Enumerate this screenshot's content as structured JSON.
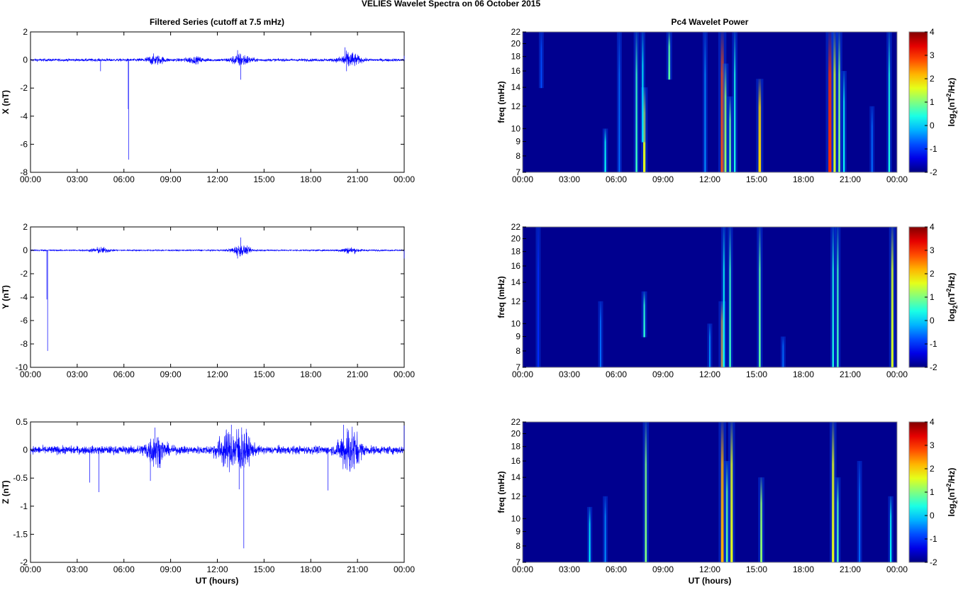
{
  "title": "VELIES Wavelet Spectra on 06 October   2015",
  "left_title": "Filtered Series (cutoff at 7.5 mHz)",
  "right_title": "Pc4 Wavelet Power",
  "xlabel": "UT (hours)",
  "xticks": [
    "00:00",
    "03:00",
    "06:00",
    "09:00",
    "12:00",
    "15:00",
    "18:00",
    "21:00",
    "00:00"
  ],
  "colors": {
    "series": "#0000ff",
    "background": "#00008f"
  },
  "chart_data": {
    "type": "line",
    "x_range_hours": [
      0,
      24
    ],
    "time_series": [
      {
        "ylabel": "X (nT)",
        "ylim": [
          -8,
          2
        ],
        "yticks": [
          "-8",
          "-6",
          "-4",
          "-2",
          "0",
          "2"
        ],
        "yvals": [
          -8,
          -6,
          -4,
          -2,
          0,
          2
        ],
        "noise_amp": 0.08,
        "bursts": [
          [
            8.0,
            0.25
          ],
          [
            13.5,
            0.35
          ],
          [
            20.5,
            0.45
          ],
          [
            10.5,
            0.15
          ]
        ],
        "spikes": [
          [
            6.3,
            -7.1
          ],
          [
            6.28,
            -3.5
          ],
          [
            4.5,
            -0.8
          ],
          [
            13.5,
            -1.4
          ],
          [
            13.3,
            0.7
          ],
          [
            20.2,
            0.9
          ],
          [
            20.3,
            -0.8
          ],
          [
            24.0,
            0.3
          ]
        ]
      },
      {
        "ylabel": "Y (nT)",
        "ylim": [
          -10,
          2
        ],
        "yticks": [
          "-10",
          "-8",
          "-6",
          "-4",
          "-2",
          "0",
          "2"
        ],
        "yvals": [
          -10,
          -8,
          -6,
          -4,
          -2,
          0,
          2
        ],
        "noise_amp": 0.05,
        "bursts": [
          [
            13.5,
            0.35
          ],
          [
            20.5,
            0.2
          ],
          [
            4.5,
            0.2
          ]
        ],
        "spikes": [
          [
            1.1,
            -8.6
          ],
          [
            1.05,
            -4.2
          ],
          [
            13.5,
            1.1
          ],
          [
            13.3,
            -0.7
          ],
          [
            24.0,
            -0.7
          ]
        ]
      },
      {
        "ylabel": "Z (nT)",
        "ylim": [
          -2,
          0.5
        ],
        "yticks": [
          "-2",
          "-1.5",
          "-1",
          "-0.5",
          "0",
          "0.5"
        ],
        "yvals": [
          -2,
          -1.5,
          -1,
          -0.5,
          0,
          0.5
        ],
        "noise_amp": 0.06,
        "bursts": [
          [
            8.0,
            0.2
          ],
          [
            13.5,
            0.3
          ],
          [
            20.5,
            0.35
          ],
          [
            12.5,
            0.2
          ]
        ],
        "spikes": [
          [
            13.7,
            -1.75
          ],
          [
            4.4,
            -0.75
          ],
          [
            3.8,
            -0.58
          ],
          [
            19.1,
            -0.72
          ],
          [
            13.4,
            -0.7
          ],
          [
            7.7,
            -0.55
          ],
          [
            8.0,
            0.4
          ],
          [
            12.9,
            0.45
          ],
          [
            20.1,
            0.45
          ],
          [
            24.0,
            0.5
          ]
        ]
      }
    ],
    "spectra": {
      "ylabel": "freq (mHz)",
      "ylim_mhz": [
        7,
        22
      ],
      "yscale": "log",
      "yticks": [
        "7",
        "8",
        "9",
        "10",
        "12",
        "14",
        "16",
        "18",
        "20",
        "22"
      ],
      "yvals": [
        7,
        8,
        9,
        10,
        12,
        14,
        16,
        18,
        20,
        22
      ],
      "clim": [
        -2,
        4
      ],
      "colorbar_ticks": [
        "-2",
        "-1",
        "0",
        "1",
        "2",
        "3",
        "4"
      ],
      "colorbar_vals": [
        -2,
        -1,
        0,
        1,
        2,
        3,
        4
      ],
      "colorbar_label": [
        "log",
        "2",
        "(nT",
        "2",
        "/Hz)"
      ],
      "panels": [
        {
          "events_hour_fmin_fmax_log2power": [
            [
              1.2,
              14,
              22,
              -0.8
            ],
            [
              5.3,
              7,
              10,
              0.3
            ],
            [
              6.2,
              7,
              22,
              -0.6
            ],
            [
              7.3,
              7,
              22,
              0.6
            ],
            [
              7.8,
              7,
              14,
              1.6
            ],
            [
              7.7,
              9,
              22,
              0.2
            ],
            [
              9.4,
              15,
              22,
              0.8
            ],
            [
              11.7,
              7,
              22,
              -0.4
            ],
            [
              12.8,
              7,
              22,
              2.8
            ],
            [
              13.0,
              7,
              17,
              1.1
            ],
            [
              13.3,
              7,
              13,
              0.8
            ],
            [
              13.6,
              7,
              22,
              0.4
            ],
            [
              15.2,
              7,
              15,
              2.0
            ],
            [
              19.7,
              7,
              22,
              3.0
            ],
            [
              20.0,
              7,
              22,
              1.5
            ],
            [
              20.3,
              7,
              22,
              1.0
            ],
            [
              20.6,
              7,
              16,
              0.3
            ],
            [
              22.4,
              7,
              12,
              -0.6
            ],
            [
              23.5,
              7,
              22,
              0.4
            ]
          ]
        },
        {
          "events_hour_fmin_fmax_log2power": [
            [
              1.0,
              7,
              22,
              -1.0
            ],
            [
              5.0,
              7,
              12,
              -0.6
            ],
            [
              7.8,
              9,
              13,
              0.5
            ],
            [
              12.0,
              7,
              10,
              -0.4
            ],
            [
              12.8,
              7,
              12,
              2.2
            ],
            [
              12.9,
              7,
              22,
              0.3
            ],
            [
              13.3,
              7,
              22,
              0.6
            ],
            [
              15.2,
              7,
              22,
              0.8
            ],
            [
              16.7,
              7,
              9,
              -0.6
            ],
            [
              19.9,
              7,
              22,
              0.4
            ],
            [
              20.2,
              7,
              22,
              0.6
            ],
            [
              23.7,
              7,
              22,
              1.5
            ]
          ]
        },
        {
          "events_hour_fmin_fmax_log2power": [
            [
              4.3,
              7,
              11,
              0.2
            ],
            [
              5.3,
              7,
              12,
              -0.4
            ],
            [
              7.9,
              7,
              22,
              1.0
            ],
            [
              12.8,
              7,
              22,
              2.2
            ],
            [
              13.1,
              7,
              16,
              0.8
            ],
            [
              13.4,
              7,
              22,
              1.6
            ],
            [
              15.3,
              7,
              14,
              1.1
            ],
            [
              19.9,
              7,
              22,
              1.6
            ],
            [
              20.2,
              7,
              14,
              0.7
            ],
            [
              21.6,
              7,
              16,
              -0.6
            ],
            [
              23.6,
              7,
              12,
              0.3
            ]
          ]
        }
      ]
    }
  }
}
